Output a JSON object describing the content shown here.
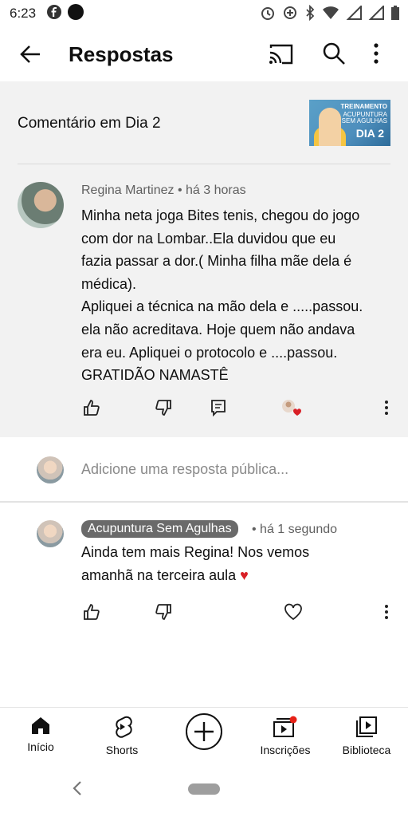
{
  "status": {
    "time": "6:23"
  },
  "appbar": {
    "title": "Respostas"
  },
  "context": {
    "label": "Comentário em Dia 2",
    "thumb": {
      "line1": "TREINAMENTO",
      "line2": "ACUPUNTURA",
      "line3": "SEM AGULHAS",
      "line4": "DIA 2"
    }
  },
  "comment": {
    "author": "Regina Martinez",
    "separator": "•",
    "time": "há 3 horas",
    "lines": [
      "Minha neta joga Bites tenis, chegou do jogo",
      "com dor na Lombar..Ela duvidou que eu",
      "fazia passar a dor.( Minha filha mãe dela é",
      "médica).",
      "Apliquei a técnica na mão dela e .....passou.",
      "ela não acreditava. Hoje quem não andava",
      "era eu. Apliquei o protocolo e ....passou.",
      "GRATIDÃO NAMASTÊ"
    ]
  },
  "reply_input": {
    "placeholder": "Adicione uma resposta pública..."
  },
  "reply": {
    "author": "Acupuntura Sem Agulhas",
    "time": "• há 1 segundo",
    "lines": [
      "Ainda tem mais Regina! Nos vemos",
      "amanhã na terceira aula"
    ],
    "emoji": "♥"
  },
  "nav": {
    "items": [
      {
        "label": "Início"
      },
      {
        "label": "Shorts"
      },
      {
        "label": ""
      },
      {
        "label": "Inscrições"
      },
      {
        "label": "Biblioteca"
      }
    ]
  },
  "colors": {
    "accent_red": "#d91f26",
    "bg_gray": "#f2f2f2"
  }
}
